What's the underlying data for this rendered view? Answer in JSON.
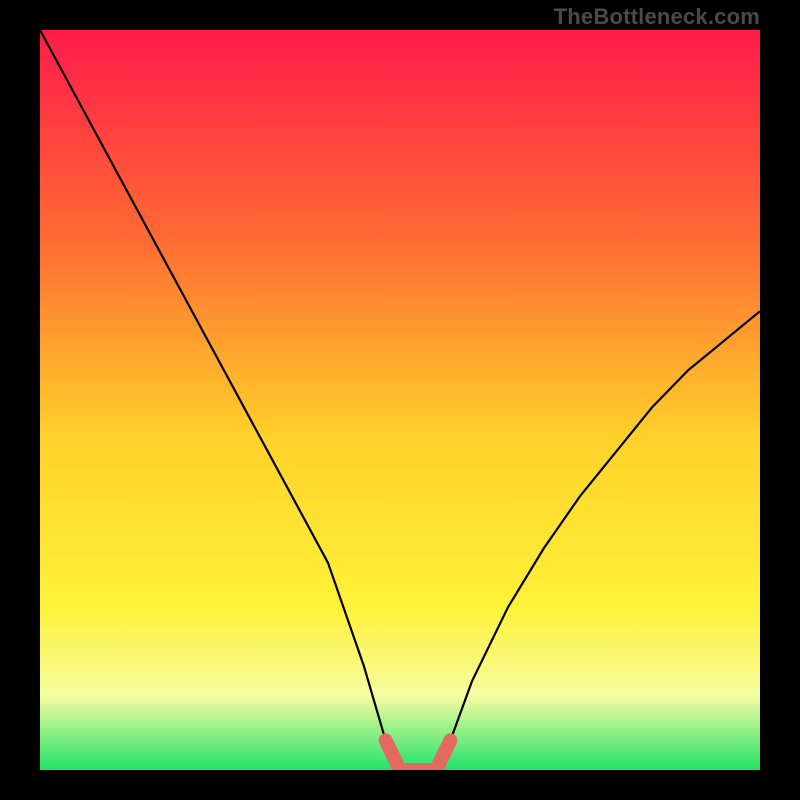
{
  "watermark": "TheBottleneck.com",
  "colors": {
    "frame": "#000000",
    "gradient_top": "#ff1b4b",
    "gradient_mid1": "#ff7a2e",
    "gradient_mid2": "#ffd92a",
    "gradient_mid3": "#fdf96a",
    "gradient_bottom": "#22e36b",
    "curve": "#000000",
    "marker": "#e46a61",
    "watermark": "#4a4a4a"
  },
  "chart_data": {
    "type": "line",
    "title": "",
    "xlabel": "",
    "ylabel": "",
    "xlim": [
      0,
      100
    ],
    "ylim": [
      0,
      100
    ],
    "series": [
      {
        "name": "bottleneck-curve",
        "x": [
          0,
          5,
          10,
          15,
          20,
          25,
          30,
          35,
          40,
          45,
          48,
          50,
          52,
          55,
          57,
          60,
          65,
          70,
          75,
          80,
          85,
          90,
          95,
          100
        ],
        "y": [
          100,
          91,
          82,
          73,
          64,
          55,
          46,
          37,
          28,
          14,
          4,
          0,
          0,
          0,
          4,
          12,
          22,
          30,
          37,
          43,
          49,
          54,
          58,
          62
        ]
      },
      {
        "name": "optimal-zone",
        "x": [
          48,
          49,
          50,
          51,
          52,
          53,
          54,
          55,
          56,
          57
        ],
        "y": [
          4,
          2,
          0,
          0,
          0,
          0,
          0,
          0,
          2,
          4
        ]
      }
    ],
    "annotations": []
  }
}
